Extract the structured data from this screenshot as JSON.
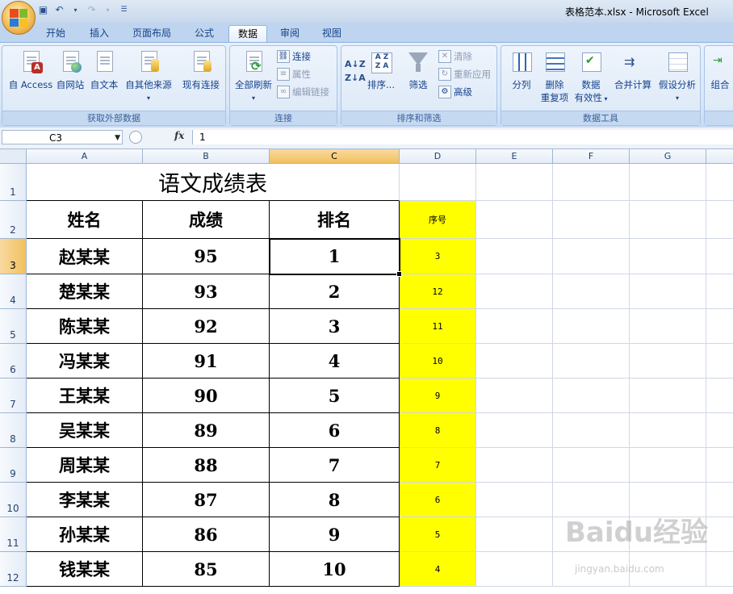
{
  "window": {
    "title": "表格范本.xlsx - Microsoft Excel"
  },
  "tabs": [
    "开始",
    "插入",
    "页面布局",
    "公式",
    "数据",
    "审阅",
    "视图"
  ],
  "active_tab": "数据",
  "ribbon": {
    "external_group": {
      "title": "获取外部数据",
      "buttons": [
        "自 Access",
        "自网站",
        "自文本",
        "自其他来源",
        "现有连接"
      ]
    },
    "connections_group": {
      "title": "连接",
      "refresh": "全部刷新",
      "items": [
        "连接",
        "属性",
        "编辑链接"
      ]
    },
    "sort_group": {
      "title": "排序和筛选",
      "sort": "排序...",
      "filter": "筛选",
      "items": [
        "清除",
        "重新应用",
        "高级"
      ]
    },
    "tools_group": {
      "title": "数据工具",
      "split": "分列",
      "remove_dup": [
        "删除",
        "重复项"
      ],
      "validation": [
        "数据",
        "有效性"
      ],
      "consolidate": "合并计算",
      "whatif": "假设分析"
    },
    "outline_group": {
      "group_btn": "组合"
    }
  },
  "formula_bar": {
    "name_box": "C3",
    "fx": "fx",
    "formula": "1"
  },
  "columns": [
    "A",
    "B",
    "C",
    "D",
    "E",
    "F",
    "G"
  ],
  "rows": [
    "1",
    "2",
    "3",
    "4",
    "5",
    "6",
    "7",
    "8",
    "9",
    "10",
    "11",
    "12"
  ],
  "sheet": {
    "title": "语文成绩表",
    "headers": [
      "姓名",
      "成绩",
      "排名",
      "序号"
    ],
    "data": [
      [
        "赵某某",
        "95",
        "1",
        "3"
      ],
      [
        "楚某某",
        "93",
        "2",
        "12"
      ],
      [
        "陈某某",
        "92",
        "3",
        "11"
      ],
      [
        "冯某某",
        "91",
        "4",
        "10"
      ],
      [
        "王某某",
        "90",
        "5",
        "9"
      ],
      [
        "吴某某",
        "89",
        "6",
        "8"
      ],
      [
        "周某某",
        "88",
        "7",
        "7"
      ],
      [
        "李某某",
        "87",
        "8",
        "6"
      ],
      [
        "孙某某",
        "86",
        "9",
        "5"
      ],
      [
        "钱某某",
        "85",
        "10",
        "4"
      ]
    ]
  },
  "watermark": {
    "text": "Baidu经验",
    "sub": "jingyan.baidu.com"
  },
  "colors": {
    "highlight": "#ffff00",
    "accent": "#f1c15f"
  }
}
